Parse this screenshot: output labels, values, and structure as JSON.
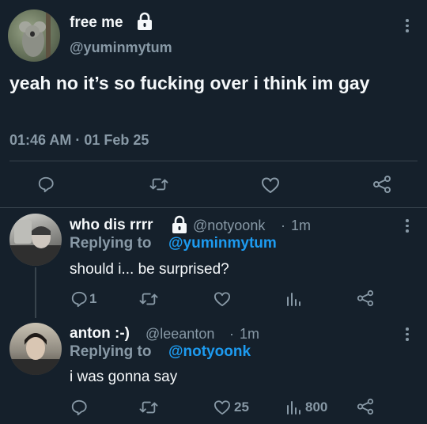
{
  "main_tweet": {
    "display_name": "free me",
    "handle": "@yuminmytum",
    "text": "yeah no it’s so fucking over i think im gay",
    "timestamp": "01:46 AM · 01 Feb 25",
    "locked": true
  },
  "replies": [
    {
      "display_name": "who dis rrrr",
      "handle": "@notyoonk",
      "separator": "·",
      "time": "1m",
      "replying_label": "Replying to",
      "replying_to": "@yuminmytum",
      "text": "should i... be surprised?",
      "reply_count": "1",
      "like_count": "",
      "view_count": "",
      "locked": true
    },
    {
      "display_name": "anton :-)",
      "handle": "@leeanton",
      "separator": "·",
      "time": "1m",
      "replying_label": "Replying to",
      "replying_to": "@notyoonk",
      "text": "i was gonna say",
      "reply_count": "",
      "like_count": "25",
      "view_count": "800",
      "locked": false
    }
  ],
  "colors": {
    "background": "#15202b",
    "text": "#e7e9ea",
    "muted": "#8899a6",
    "link": "#1d9bf0",
    "divider": "#38444d"
  },
  "icons": [
    "reply-icon",
    "retweet-icon",
    "like-icon",
    "share-icon",
    "views-icon",
    "lock-icon",
    "more-icon"
  ]
}
